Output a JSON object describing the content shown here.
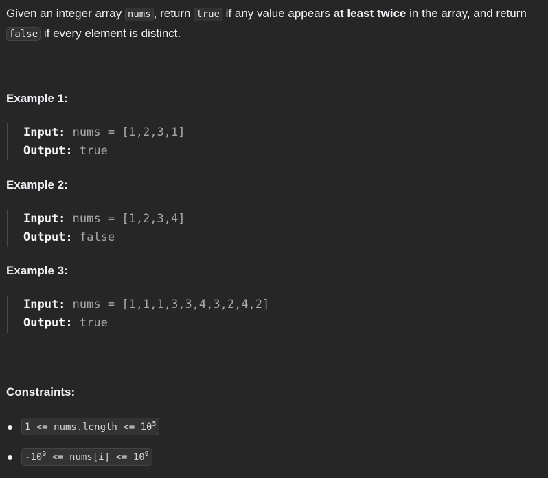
{
  "description": {
    "part1": "Given an integer array ",
    "code_nums": "nums",
    "part2": ", return ",
    "code_true": "true",
    "part3": " if any value appears ",
    "bold_phrase": "at least twice",
    "part4": " in the array, and return ",
    "code_false": "false",
    "part5": " if every element is distinct."
  },
  "examples": [
    {
      "title": "Example 1:",
      "input_label": "Input:",
      "input_value": "nums = [1,2,3,1]",
      "output_label": "Output:",
      "output_value": "true"
    },
    {
      "title": "Example 2:",
      "input_label": "Input:",
      "input_value": "nums = [1,2,3,4]",
      "output_label": "Output:",
      "output_value": "false"
    },
    {
      "title": "Example 3:",
      "input_label": "Input:",
      "input_value": "nums = [1,1,1,3,3,4,3,2,4,2]",
      "output_label": "Output:",
      "output_value": "true"
    }
  ],
  "constraints": {
    "title": "Constraints:",
    "items": [
      {
        "prefix": "1 <= nums.length <= 10",
        "sup": "5"
      },
      {
        "prefix": "-10",
        "sup1": "9",
        "middle": " <= nums[i] <= 10",
        "sup2": "9"
      }
    ]
  }
}
